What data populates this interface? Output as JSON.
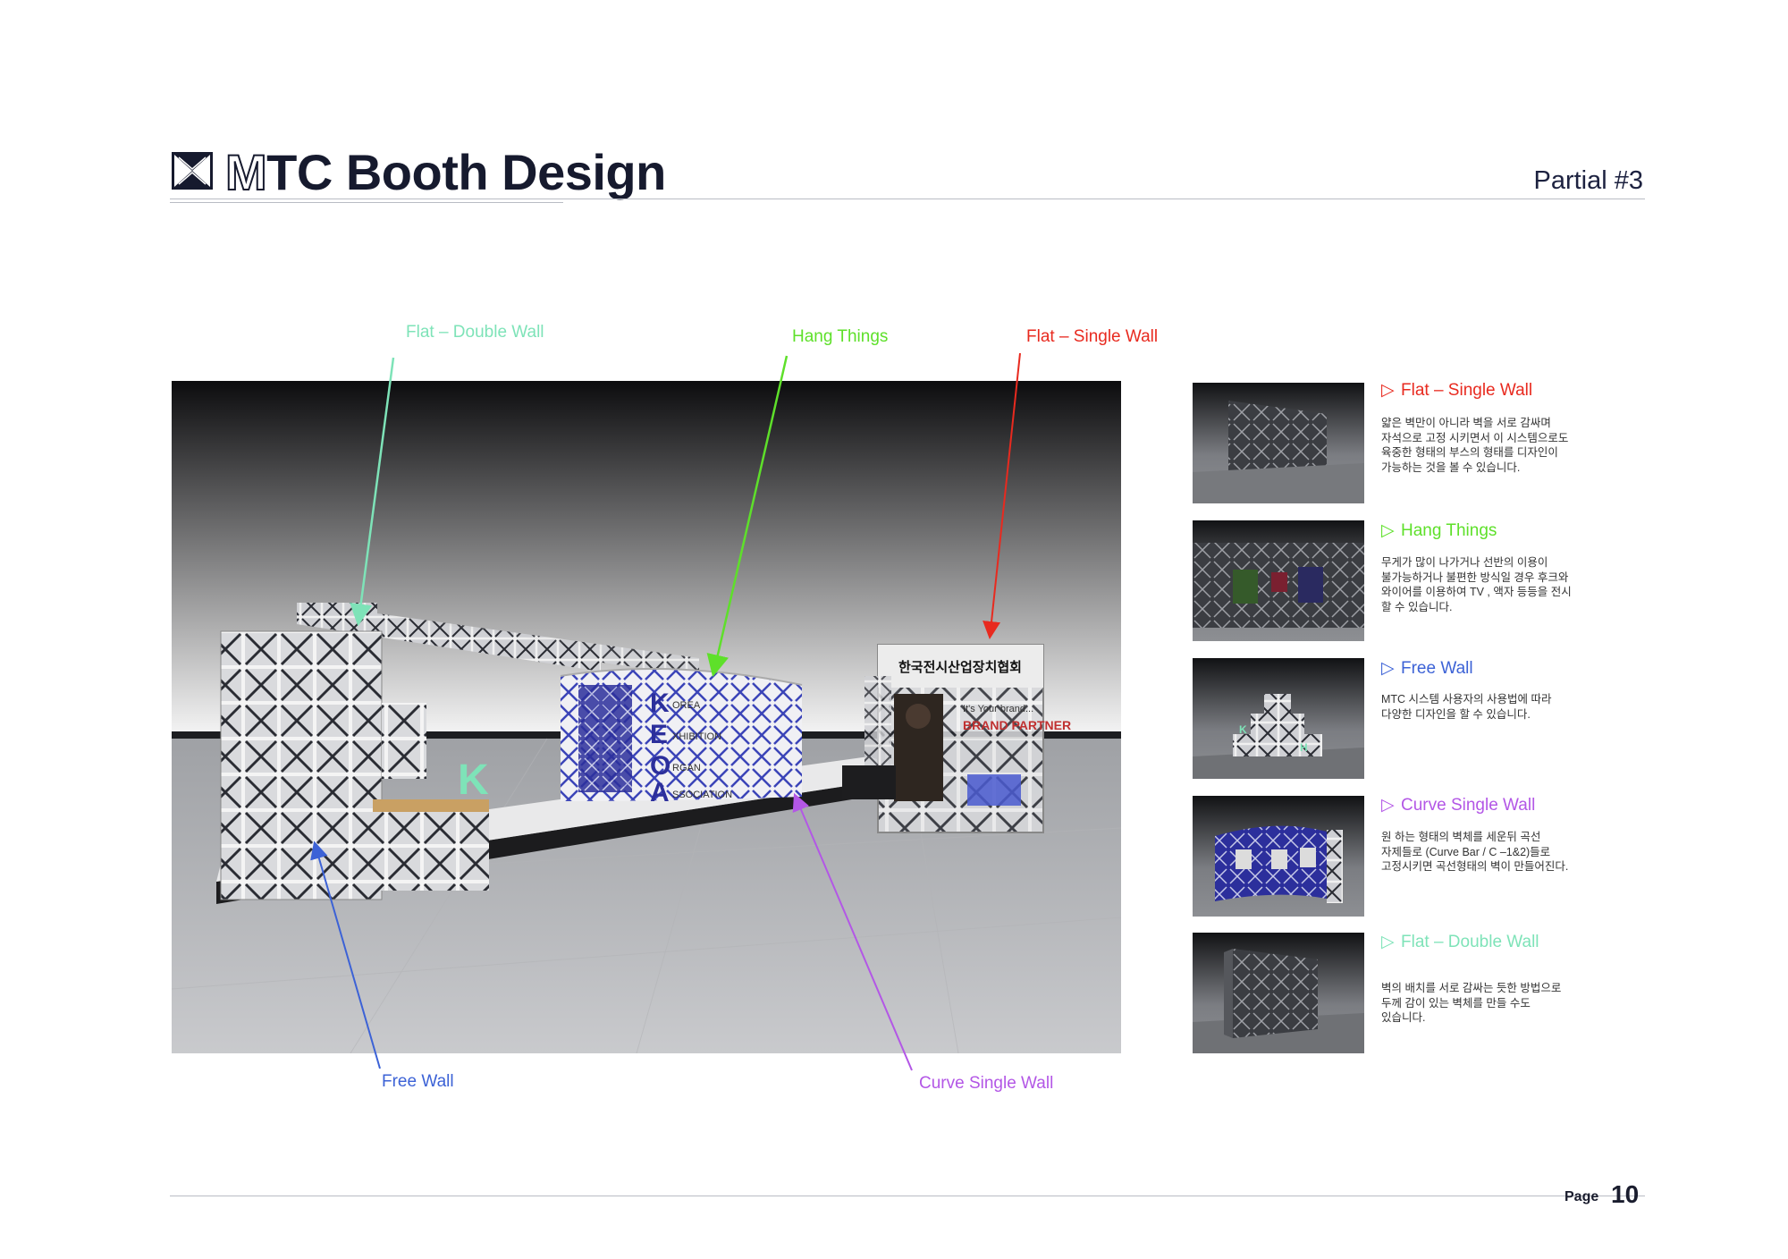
{
  "header": {
    "title_mark": "M",
    "title_rest": "TC Booth Design",
    "partial": "Partial #3"
  },
  "colors": {
    "flat_double": "#7ee3b8",
    "hang": "#5ee02a",
    "flat_single": "#e82a1f",
    "free": "#3c62d6",
    "curve": "#b357e6"
  },
  "callouts": {
    "flat_double": "Flat – Double Wall",
    "hang": "Hang Things",
    "flat_single": "Flat – Single Wall",
    "free": "Free Wall",
    "curve": "Curve Single Wall"
  },
  "render": {
    "sign_text": "한국전시산업장치협회",
    "banner_line1": "It's Your brand...",
    "banner_line2": "BRAND PARTNER",
    "letters": [
      "K",
      "E",
      "O",
      "A"
    ],
    "letter_words": [
      "OREA",
      "XHIBITION",
      "RGAN",
      "SSOCIATION"
    ]
  },
  "side": [
    {
      "icon": "play-triangle-icon",
      "title": "Flat – Single Wall",
      "desc": "얇은 벽만이 아니라 벽을 서로 감싸며\n자석으로 고정 시키면서 이 시스템으로도\n육중한 형태의 부스의 형태를 디자인이\n가능하는 것을 볼 수 있습니다."
    },
    {
      "icon": "play-triangle-icon",
      "title": "Hang Things",
      "desc": "무게가 많이 나가거나 선반의 이용이\n불가능하거나 불편한 방식일 경우 후크와\n와이어를 이용하여 TV , 액자 등등을 전시\n할 수 있습니다."
    },
    {
      "icon": "play-triangle-icon",
      "title": "Free Wall",
      "desc": "MTC 시스템 사용자의 사용법에 따라\n다양한 디자인을 할 수 있습니다."
    },
    {
      "icon": "play-triangle-icon",
      "title": "Curve Single Wall",
      "desc": "원 하는 형태의 벽체를 세운뒤 곡선\n자제들로 (Curve Bar / C –1&2)들로\n고정시키면 곡선형태의 벽이 만들어진다."
    },
    {
      "icon": "play-triangle-icon",
      "title": "Flat – Double Wall",
      "desc": "벽의 배치를 서로 감싸는 듯한 방법으로\n두께 감이 있는 벽체를 만들 수도\n있습니다."
    }
  ],
  "footer": {
    "page_label": "Page",
    "page_number": "10"
  }
}
